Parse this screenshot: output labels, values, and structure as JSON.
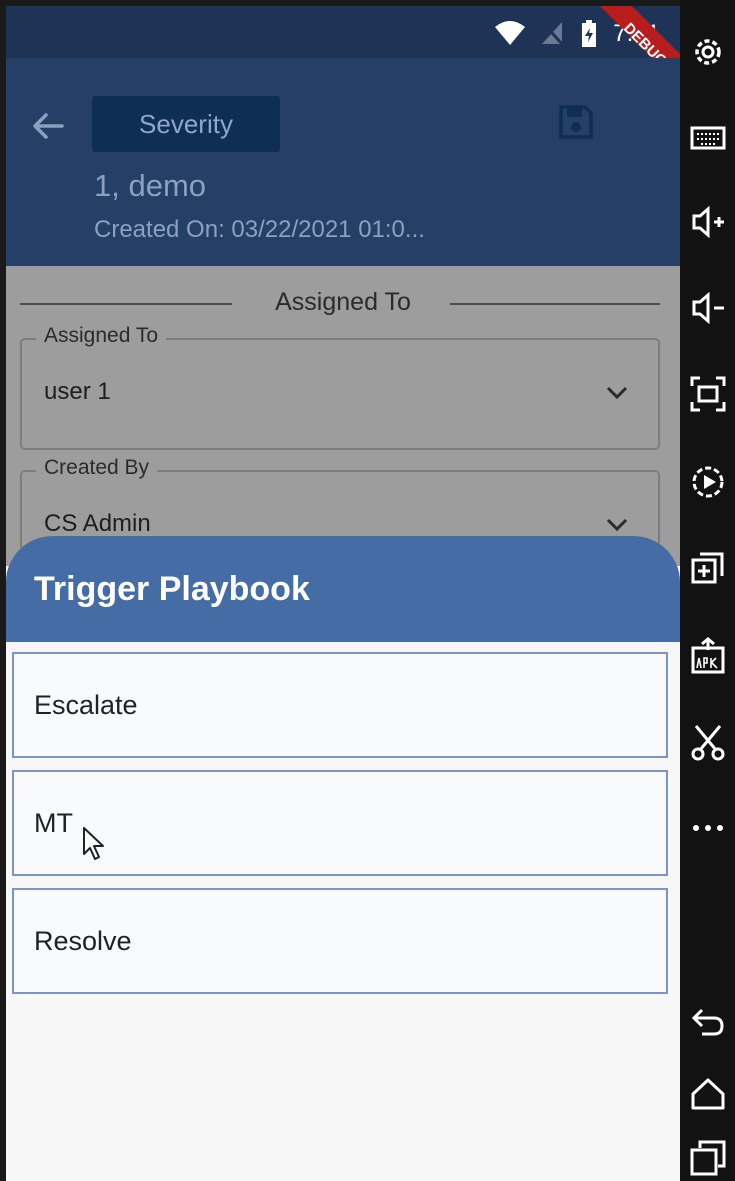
{
  "status_bar": {
    "time": "7:31",
    "debug_banner": "DEBUG"
  },
  "app_bar": {
    "severity_label": "Severity",
    "ticket_title": "1, demo",
    "created_on": "Created On: 03/22/2021 01:0..."
  },
  "form": {
    "section_heading": "Assigned To",
    "fields": [
      {
        "label": "Assigned To",
        "value": "user 1"
      },
      {
        "label": "Created By",
        "value": "CS Admin"
      }
    ]
  },
  "sheet": {
    "title": "Trigger Playbook",
    "items": [
      "Escalate",
      "MT",
      "Resolve"
    ]
  },
  "colors": {
    "status_bar": "#1e3355",
    "app_bar": "#263f66",
    "sheet_header": "#456ca5",
    "item_border": "#7c94c4",
    "debug_banner": "#b81c1c"
  },
  "sidebar_icons": [
    "settings-icon",
    "keyboard-icon",
    "volume-up-icon",
    "volume-down-icon",
    "screenshot-icon",
    "screen-record-icon",
    "add-instance-icon",
    "install-apk-icon",
    "cut-icon",
    "more-icon",
    "back-icon",
    "home-icon",
    "recents-icon"
  ]
}
